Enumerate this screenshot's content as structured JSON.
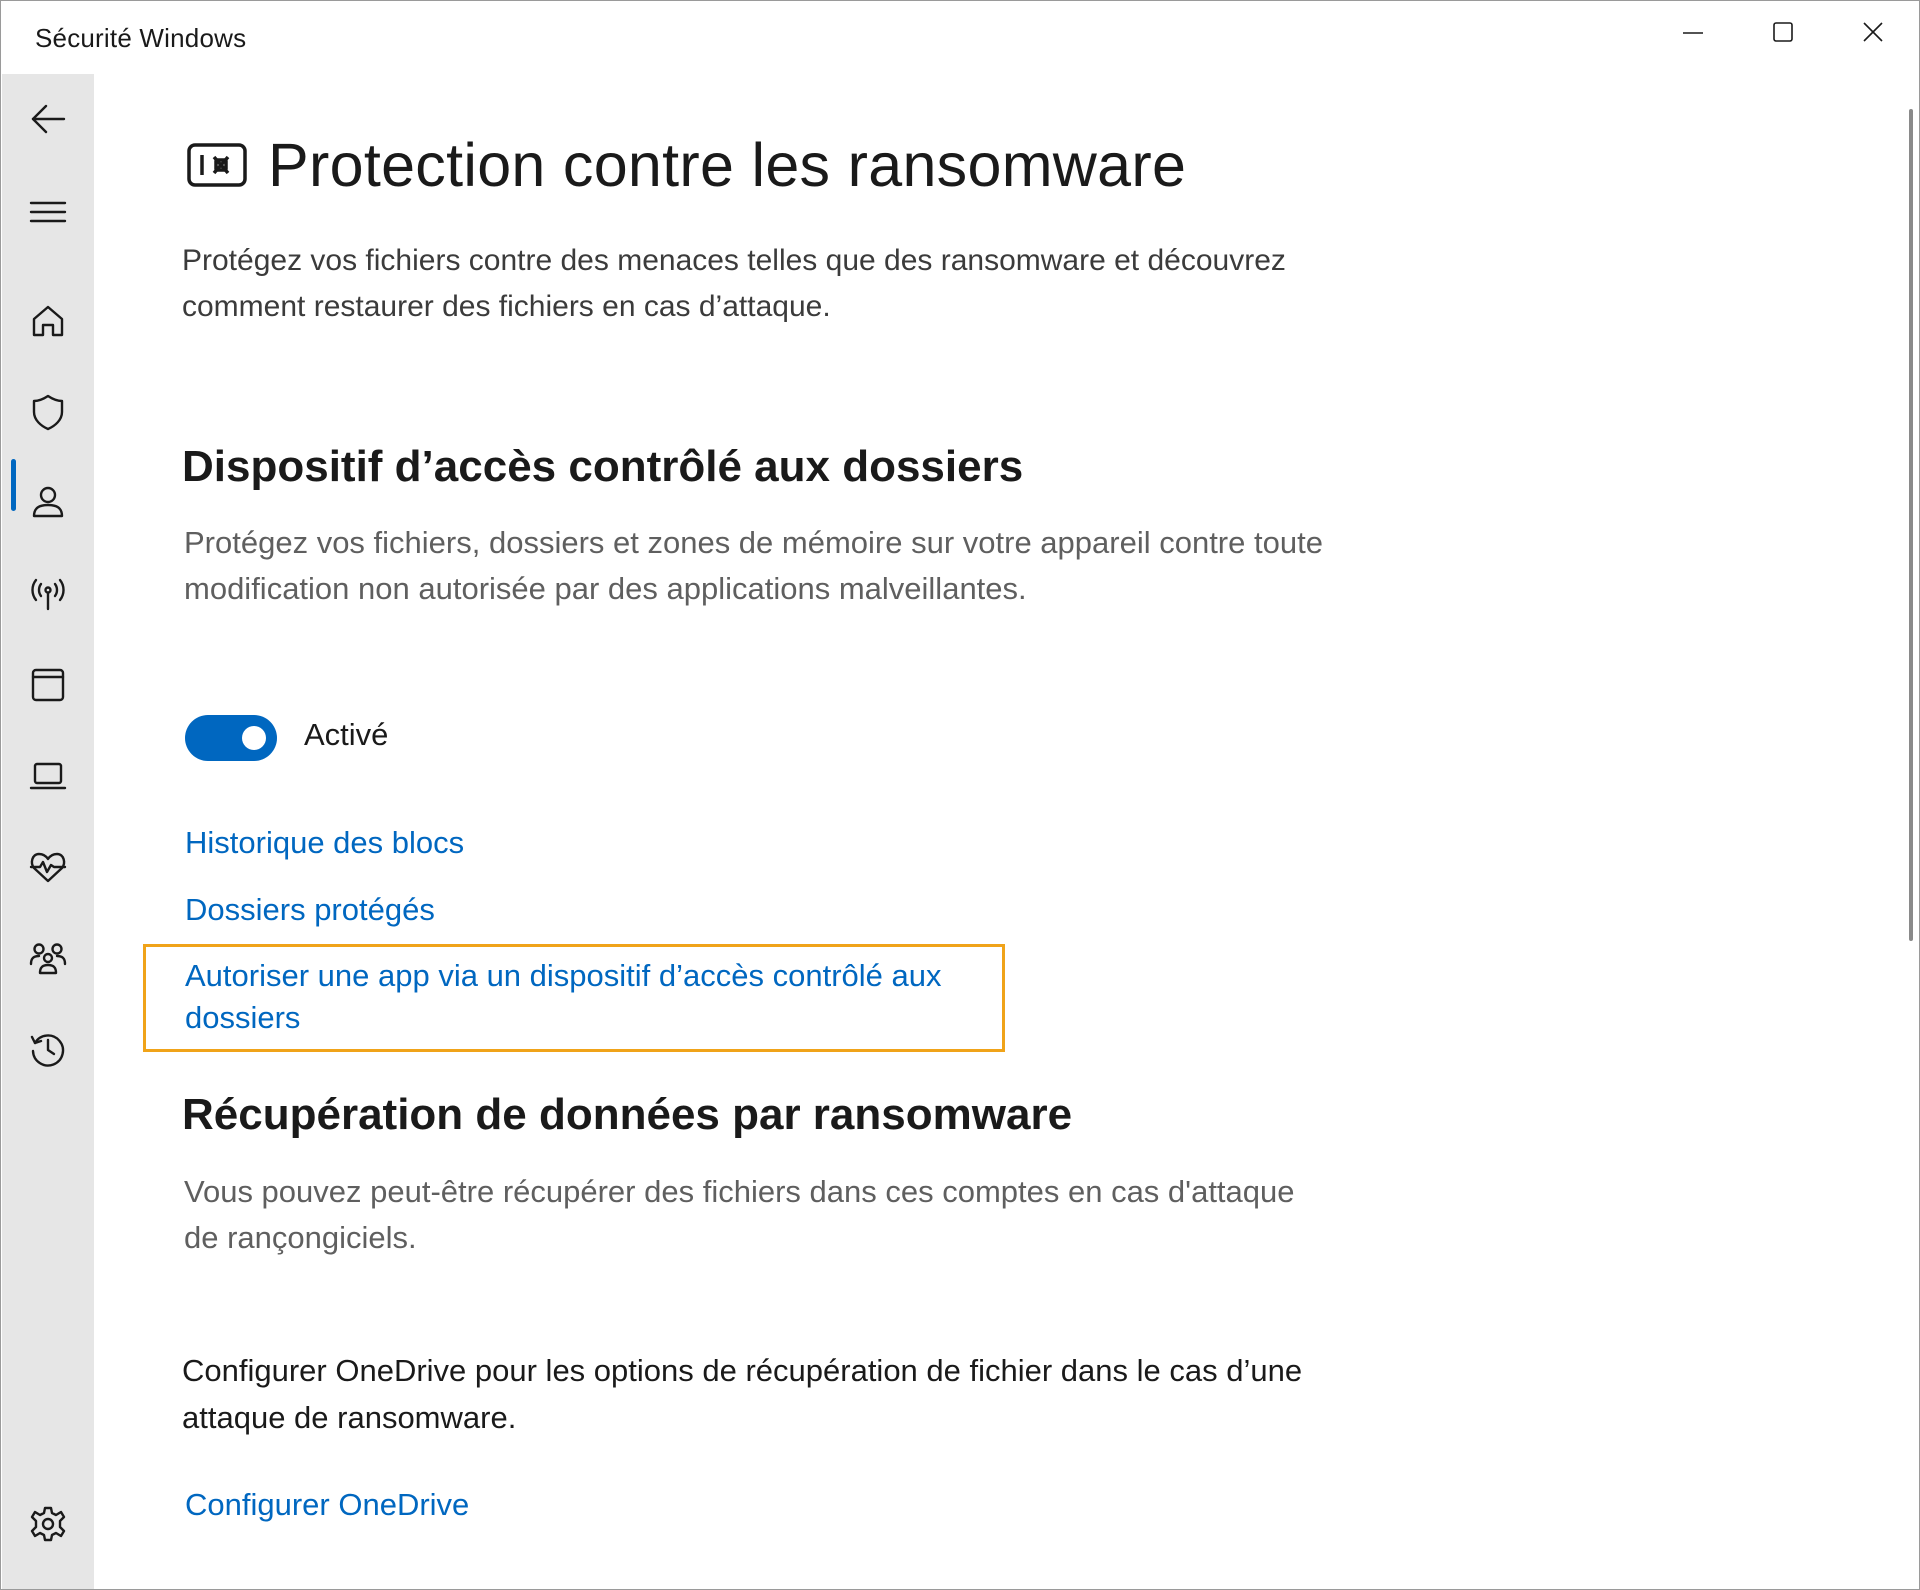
{
  "window": {
    "title": "Sécurité Windows",
    "controls": [
      "minimize-icon",
      "maximize-icon",
      "close-icon"
    ]
  },
  "sidebar": {
    "items": [
      {
        "name": "back",
        "icon": "back-arrow-icon"
      },
      {
        "name": "menu",
        "icon": "hamburger-menu-icon"
      },
      {
        "name": "home",
        "icon": "home-icon"
      },
      {
        "name": "virus-protection",
        "icon": "shield-icon",
        "selected": true
      },
      {
        "name": "account-protection",
        "icon": "person-icon"
      },
      {
        "name": "firewall-network",
        "icon": "wireless-antenna-icon"
      },
      {
        "name": "app-browser-control",
        "icon": "app-window-icon"
      },
      {
        "name": "device-security",
        "icon": "laptop-icon"
      },
      {
        "name": "device-performance",
        "icon": "heart-pulse-icon"
      },
      {
        "name": "family-options",
        "icon": "family-icon"
      },
      {
        "name": "protection-history",
        "icon": "history-icon"
      },
      {
        "name": "settings",
        "icon": "gear-icon"
      }
    ],
    "accent": "#0067c0"
  },
  "page": {
    "icon": "ransomware-safe-icon",
    "title": "Protection contre les ransomware",
    "intro": "Protégez vos fichiers contre des menaces telles que des ransomware et découvrez comment restaurer des fichiers en cas d’attaque."
  },
  "cfa": {
    "title": "Dispositif d’accès contrôlé aux dossiers",
    "description": "Protégez vos fichiers, dossiers et zones de mémoire sur votre appareil contre toute modification non autorisée par des applications malveillantes.",
    "toggle_state": "on",
    "toggle_label": "Activé",
    "links": {
      "history": "Historique des blocs",
      "protected": "Dossiers protégés",
      "allow_app": "Autoriser une app via un dispositif d’accès contrôlé aux dossiers"
    },
    "highlight_color": "#f0a319"
  },
  "recovery": {
    "title": "Récupération de données par ransomware",
    "description": "Vous pouvez peut-être récupérer des fichiers dans ces comptes en cas d'attaque de rançongiciels.",
    "onedrive_text": "Configurer OneDrive pour les options de récupération de fichier dans le cas d’une attaque de ransomware.",
    "onedrive_link": "Configurer OneDrive"
  },
  "colors": {
    "link": "#0067c0",
    "sidebar_bg": "#e6e6e6",
    "toggle_on": "#0067c0"
  }
}
